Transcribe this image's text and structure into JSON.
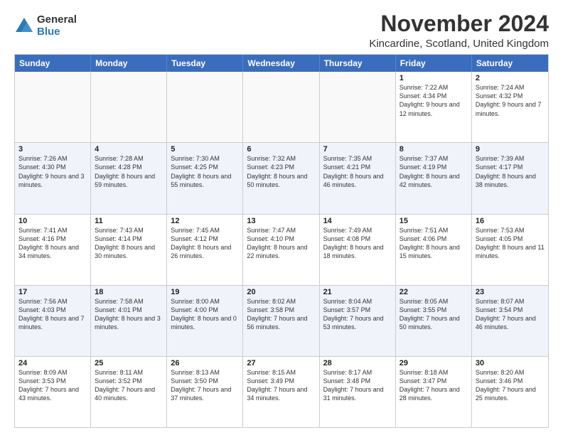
{
  "logo": {
    "general": "General",
    "blue": "Blue"
  },
  "title": "November 2024",
  "subtitle": "Kincardine, Scotland, United Kingdom",
  "headers": [
    "Sunday",
    "Monday",
    "Tuesday",
    "Wednesday",
    "Thursday",
    "Friday",
    "Saturday"
  ],
  "rows": [
    [
      {
        "day": "",
        "info": "",
        "empty": true
      },
      {
        "day": "",
        "info": "",
        "empty": true
      },
      {
        "day": "",
        "info": "",
        "empty": true
      },
      {
        "day": "",
        "info": "",
        "empty": true
      },
      {
        "day": "",
        "info": "",
        "empty": true
      },
      {
        "day": "1",
        "info": "Sunrise: 7:22 AM\nSunset: 4:34 PM\nDaylight: 9 hours and 12 minutes."
      },
      {
        "day": "2",
        "info": "Sunrise: 7:24 AM\nSunset: 4:32 PM\nDaylight: 9 hours and 7 minutes."
      }
    ],
    [
      {
        "day": "3",
        "info": "Sunrise: 7:26 AM\nSunset: 4:30 PM\nDaylight: 9 hours and 3 minutes."
      },
      {
        "day": "4",
        "info": "Sunrise: 7:28 AM\nSunset: 4:28 PM\nDaylight: 8 hours and 59 minutes."
      },
      {
        "day": "5",
        "info": "Sunrise: 7:30 AM\nSunset: 4:25 PM\nDaylight: 8 hours and 55 minutes."
      },
      {
        "day": "6",
        "info": "Sunrise: 7:32 AM\nSunset: 4:23 PM\nDaylight: 8 hours and 50 minutes."
      },
      {
        "day": "7",
        "info": "Sunrise: 7:35 AM\nSunset: 4:21 PM\nDaylight: 8 hours and 46 minutes."
      },
      {
        "day": "8",
        "info": "Sunrise: 7:37 AM\nSunset: 4:19 PM\nDaylight: 8 hours and 42 minutes."
      },
      {
        "day": "9",
        "info": "Sunrise: 7:39 AM\nSunset: 4:17 PM\nDaylight: 8 hours and 38 minutes."
      }
    ],
    [
      {
        "day": "10",
        "info": "Sunrise: 7:41 AM\nSunset: 4:16 PM\nDaylight: 8 hours and 34 minutes."
      },
      {
        "day": "11",
        "info": "Sunrise: 7:43 AM\nSunset: 4:14 PM\nDaylight: 8 hours and 30 minutes."
      },
      {
        "day": "12",
        "info": "Sunrise: 7:45 AM\nSunset: 4:12 PM\nDaylight: 8 hours and 26 minutes."
      },
      {
        "day": "13",
        "info": "Sunrise: 7:47 AM\nSunset: 4:10 PM\nDaylight: 8 hours and 22 minutes."
      },
      {
        "day": "14",
        "info": "Sunrise: 7:49 AM\nSunset: 4:08 PM\nDaylight: 8 hours and 18 minutes."
      },
      {
        "day": "15",
        "info": "Sunrise: 7:51 AM\nSunset: 4:06 PM\nDaylight: 8 hours and 15 minutes."
      },
      {
        "day": "16",
        "info": "Sunrise: 7:53 AM\nSunset: 4:05 PM\nDaylight: 8 hours and 11 minutes."
      }
    ],
    [
      {
        "day": "17",
        "info": "Sunrise: 7:56 AM\nSunset: 4:03 PM\nDaylight: 8 hours and 7 minutes."
      },
      {
        "day": "18",
        "info": "Sunrise: 7:58 AM\nSunset: 4:01 PM\nDaylight: 8 hours and 3 minutes."
      },
      {
        "day": "19",
        "info": "Sunrise: 8:00 AM\nSunset: 4:00 PM\nDaylight: 8 hours and 0 minutes."
      },
      {
        "day": "20",
        "info": "Sunrise: 8:02 AM\nSunset: 3:58 PM\nDaylight: 7 hours and 56 minutes."
      },
      {
        "day": "21",
        "info": "Sunrise: 8:04 AM\nSunset: 3:57 PM\nDaylight: 7 hours and 53 minutes."
      },
      {
        "day": "22",
        "info": "Sunrise: 8:05 AM\nSunset: 3:55 PM\nDaylight: 7 hours and 50 minutes."
      },
      {
        "day": "23",
        "info": "Sunrise: 8:07 AM\nSunset: 3:54 PM\nDaylight: 7 hours and 46 minutes."
      }
    ],
    [
      {
        "day": "24",
        "info": "Sunrise: 8:09 AM\nSunset: 3:53 PM\nDaylight: 7 hours and 43 minutes."
      },
      {
        "day": "25",
        "info": "Sunrise: 8:11 AM\nSunset: 3:52 PM\nDaylight: 7 hours and 40 minutes."
      },
      {
        "day": "26",
        "info": "Sunrise: 8:13 AM\nSunset: 3:50 PM\nDaylight: 7 hours and 37 minutes."
      },
      {
        "day": "27",
        "info": "Sunrise: 8:15 AM\nSunset: 3:49 PM\nDaylight: 7 hours and 34 minutes."
      },
      {
        "day": "28",
        "info": "Sunrise: 8:17 AM\nSunset: 3:48 PM\nDaylight: 7 hours and 31 minutes."
      },
      {
        "day": "29",
        "info": "Sunrise: 8:18 AM\nSunset: 3:47 PM\nDaylight: 7 hours and 28 minutes."
      },
      {
        "day": "30",
        "info": "Sunrise: 8:20 AM\nSunset: 3:46 PM\nDaylight: 7 hours and 25 minutes."
      }
    ]
  ]
}
